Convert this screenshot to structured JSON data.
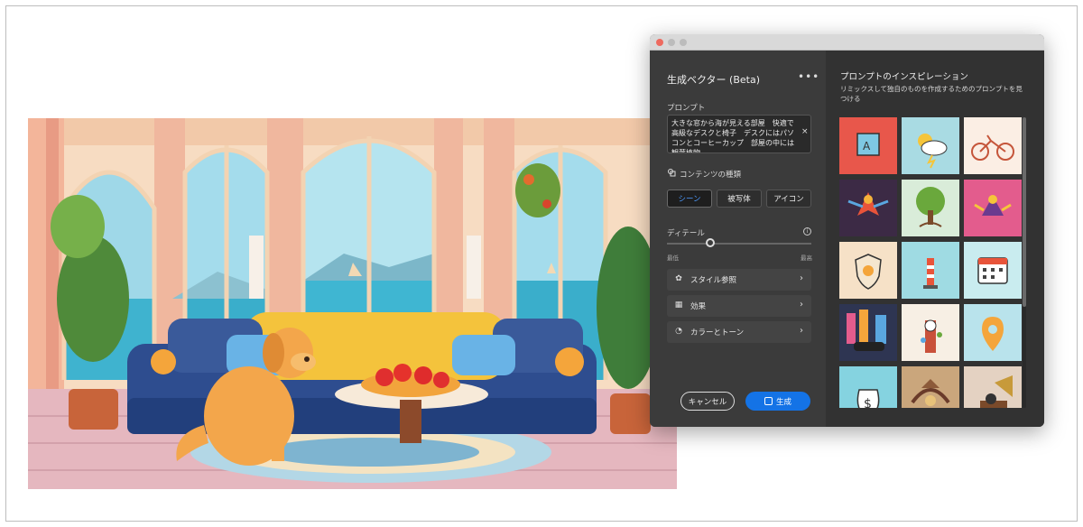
{
  "dialog": {
    "title": "生成ベクター (Beta)",
    "more_label": "•••",
    "prompt_label": "プロンプト",
    "prompt_value": "大きな窓から海が見える部屋　快適で高級なデスクと椅子　デスクにはパソコンとコーヒーカップ　部屋の中には観葉植物",
    "clear_label": "×",
    "content_type_label": "コンテンツの種類",
    "content_types": [
      {
        "label": "シーン",
        "active": true
      },
      {
        "label": "被写体",
        "active": false
      },
      {
        "label": "アイコン",
        "active": false
      }
    ],
    "detail_label": "ディテール",
    "detail_info": "i",
    "detail_value": 0.3,
    "detail_low": "最低",
    "detail_high": "最高",
    "options": [
      {
        "label": "スタイル参照",
        "icon": "style-reference-icon"
      },
      {
        "label": "効果",
        "icon": "effects-icon"
      },
      {
        "label": "カラーとトーン",
        "icon": "color-tone-icon"
      }
    ],
    "chevron": "›",
    "cancel_label": "キャンセル",
    "generate_label": "生成"
  },
  "inspiration": {
    "title": "プロンプトのインスピレーション",
    "subtitle": "リミックスして独自のものを作成するためのプロンプトを見つける",
    "tiles": [
      {
        "name": "toy-block-icon",
        "bg": "#e8574b"
      },
      {
        "name": "weather-icon",
        "bg": "#a9dbe3"
      },
      {
        "name": "bicycle-icon",
        "bg": "#fbeee4"
      },
      {
        "name": "phoenix-illustration",
        "bg": "#3c2a45"
      },
      {
        "name": "tree-illustration",
        "bg": "#d9ecd9"
      },
      {
        "name": "dragon-illustration",
        "bg": "#e35c8d"
      },
      {
        "name": "shield-icon",
        "bg": "#f6e1c7"
      },
      {
        "name": "lighthouse-icon",
        "bg": "#9fdbe3"
      },
      {
        "name": "calendar-icon",
        "bg": "#c9ecef"
      },
      {
        "name": "city-car-illustration",
        "bg": "#2e3552"
      },
      {
        "name": "clock-tower-illustration",
        "bg": "#f7efe4"
      },
      {
        "name": "location-pin-icon",
        "bg": "#b9e3ec"
      },
      {
        "name": "money-bag-icon",
        "bg": "#85d3e0"
      },
      {
        "name": "dragon-map-illustration",
        "bg": "#caa67c"
      },
      {
        "name": "gramophone-illustration",
        "bg": "#e4d2c2"
      }
    ]
  }
}
